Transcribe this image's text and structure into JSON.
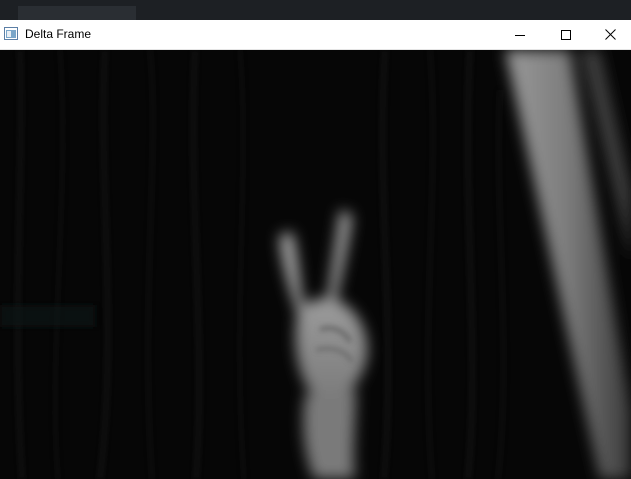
{
  "window": {
    "title": "Delta Frame",
    "controls": {
      "minimize_icon": "minimize-icon",
      "maximize_icon": "maximize-icon",
      "close_icon": "close-icon"
    }
  },
  "colors": {
    "titlebar_bg": "#ffffff",
    "frame_bg": "#070707",
    "desktop_bg": "#1f2126"
  }
}
